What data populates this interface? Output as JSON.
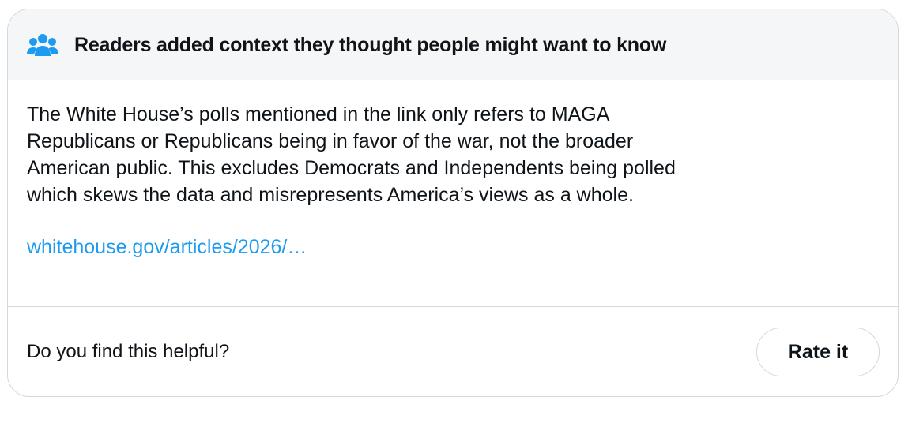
{
  "note": {
    "header_title": "Readers added context they thought people might want to know",
    "header_icon": "people-group-icon",
    "body_text": "The White House’s polls mentioned in the link only refers to MAGA\nRepublicans or Republicans being in favor of the war, not the broader\nAmerican public. This excludes Democrats and Independents being polled\nwhich skews the data and misrepresents America’s views as a whole.",
    "link_text": "whitehouse.gov/articles/2026/…",
    "helpful_question": "Do you find this helpful?",
    "rate_button_label": "Rate it"
  },
  "colors": {
    "accent": "#1d9bf0",
    "header_bg": "#f5f6f7",
    "border": "#cfd9de",
    "text": "#0f1419"
  }
}
